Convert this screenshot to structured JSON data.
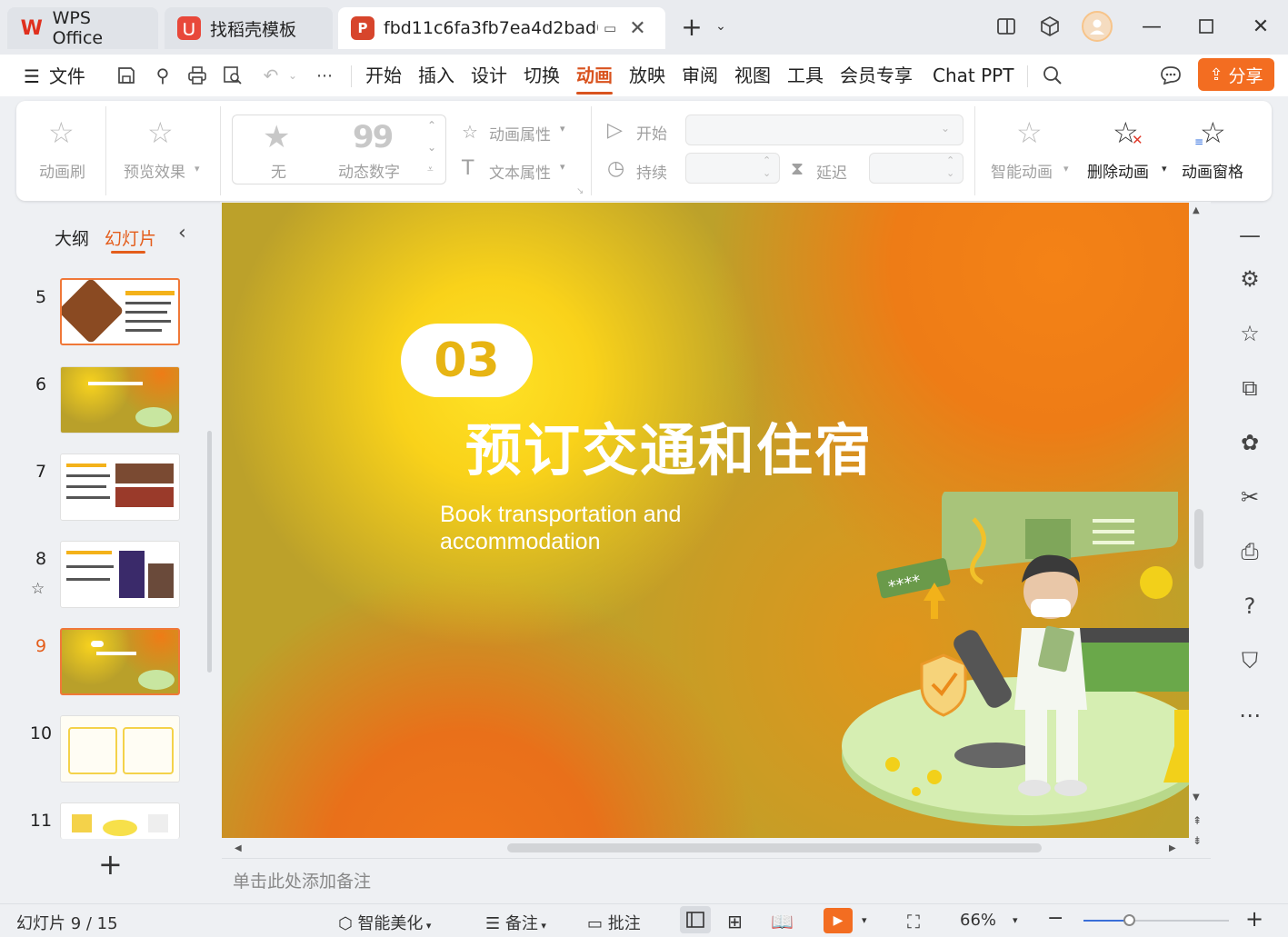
{
  "tabs": [
    {
      "label": "WPS Office",
      "icon": "wps-logo-icon",
      "color": "#e0301e"
    },
    {
      "label": "找稻壳模板",
      "icon": "docer-logo-icon",
      "color": "#e8483a"
    },
    {
      "label": "fbd11c6fa3fb7ea4d2bad0c(",
      "icon": "presentation-file-icon",
      "color": "#d7452c"
    }
  ],
  "menu": {
    "file": "文件",
    "items": [
      "开始",
      "插入",
      "设计",
      "切换",
      "动画",
      "放映",
      "审阅",
      "视图",
      "工具",
      "会员专享",
      "Chat PPT"
    ],
    "active": "动画",
    "share": "分享"
  },
  "ribbon": {
    "anim_brush": "动画刷",
    "preview": "预览效果",
    "effect_none": "无",
    "effect_dynamic_number": "动态数字",
    "dynamic_number_glyph": "99",
    "anim_props": "动画属性",
    "text_props": "文本属性",
    "start": "开始",
    "duration": "持续",
    "delay": "延迟",
    "smart_anim": "智能动画",
    "delete_anim": "删除动画",
    "anim_pane": "动画窗格"
  },
  "leftpanel": {
    "tab_outline": "大纲",
    "tab_slides": "幻灯片",
    "slides": [
      {
        "num": "5"
      },
      {
        "num": "6"
      },
      {
        "num": "7"
      },
      {
        "num": "8"
      },
      {
        "num": "9",
        "selected": true
      },
      {
        "num": "10"
      },
      {
        "num": "11"
      }
    ]
  },
  "slide": {
    "badge": "03",
    "title": "预订交通和住宿",
    "subtitle_line1": "Book transportation and",
    "subtitle_line2": "accommodation"
  },
  "notes_placeholder": "单击此处添加备注",
  "status": {
    "slide_info": "幻灯片 9 / 15",
    "beautify": "智能美化",
    "notes": "备注",
    "comment": "批注",
    "zoom": "66%"
  },
  "colors": {
    "accent": "#d9531e",
    "share_bg": "#f36d21",
    "slide_bg": "#bca12a"
  }
}
